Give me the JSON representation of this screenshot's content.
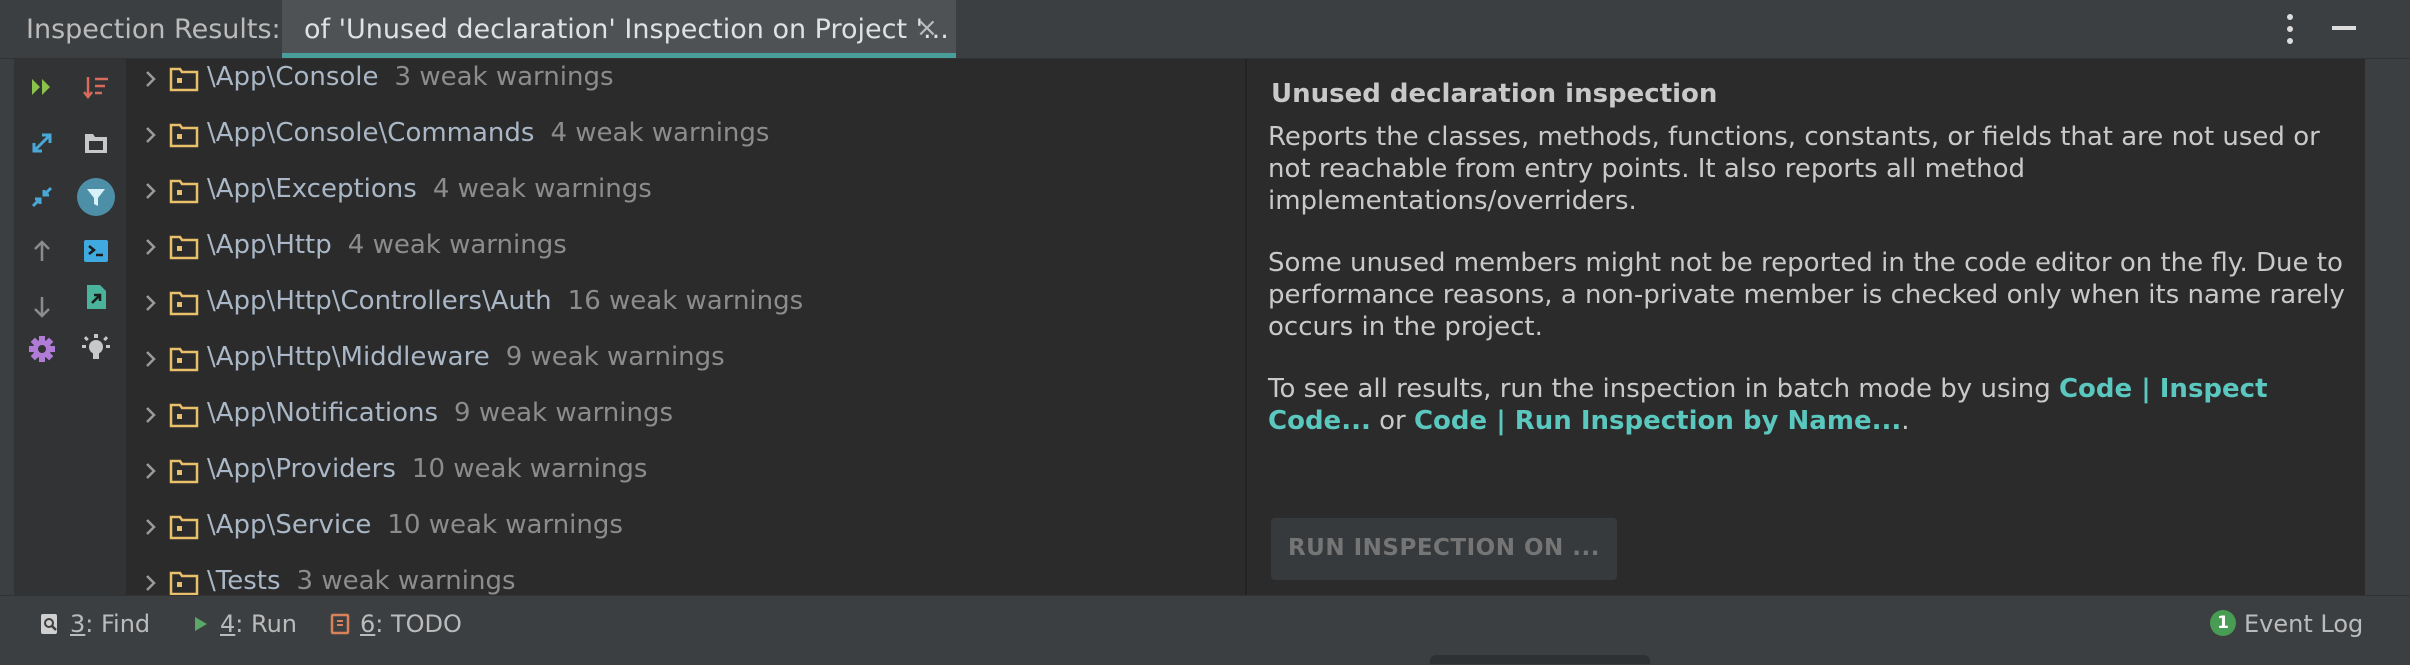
{
  "header": {
    "title": "Inspection Results:",
    "tab_label": "of 'Unused declaration' Inspection on Project '...",
    "tab_close_glyph": "×"
  },
  "toolbar": {
    "buttons": [
      {
        "name": "rerun-icon",
        "color": "#8bc34a"
      },
      {
        "name": "sort-icon",
        "color": "#d86b5b"
      },
      {
        "name": "expand-all-icon",
        "color": "#4aa8d8"
      },
      {
        "name": "group-by-directory-icon",
        "color": "#c8c8c8"
      },
      {
        "name": "collapse-all-icon",
        "color": "#4aa8d8"
      },
      {
        "name": "filter-icon",
        "color": "#4aa8d8"
      },
      {
        "name": "previous-occurrence-icon",
        "color": "#8c8c8c"
      },
      {
        "name": "autoscroll-to-source-icon",
        "color": "#3fa9e0"
      },
      {
        "name": "next-occurrence-icon",
        "color": "#8c8c8c"
      },
      {
        "name": "export-icon",
        "color": "#4ab39b"
      },
      {
        "name": "settings-icon",
        "color": "#b07cd8"
      },
      {
        "name": "quick-fix-icon",
        "color": "#c8c8c8"
      }
    ]
  },
  "tree": {
    "rows": [
      {
        "name": "\\App\\Console",
        "count": "3 weak warnings"
      },
      {
        "name": "\\App\\Console\\Commands",
        "count": "4 weak warnings"
      },
      {
        "name": "\\App\\Exceptions",
        "count": "4 weak warnings"
      },
      {
        "name": "\\App\\Http",
        "count": "4 weak warnings"
      },
      {
        "name": "\\App\\Http\\Controllers\\Auth",
        "count": "16 weak warnings"
      },
      {
        "name": "\\App\\Http\\Middleware",
        "count": "9 weak warnings"
      },
      {
        "name": "\\App\\Notifications",
        "count": "9 weak warnings"
      },
      {
        "name": "\\App\\Providers",
        "count": "10 weak warnings"
      },
      {
        "name": "\\App\\Service",
        "count": "10 weak warnings"
      },
      {
        "name": "\\Tests",
        "count": "3 weak warnings"
      }
    ]
  },
  "description": {
    "title": "Unused declaration inspection",
    "p1_line1": "Reports the classes, methods, functions, constants, or fields that are not used or",
    "p1_line2": "not reachable from entry points. It also reports all method",
    "p1_line3": "implementations/overriders.",
    "p2_line1": "Some unused members might not be reported in the code editor on the fly. Due to",
    "p2_line2": "performance reasons, a non-private member is checked only when its name rarely",
    "p2_line3": "occurs in the project.",
    "p3_prefix": "To see all results, run the inspection in batch mode by using ",
    "p3_link1_a": "Code | Inspect",
    "p3_link1_b": "Code...",
    "p3_or": " or ",
    "p3_link2": "Code | Run Inspection by Name...",
    "p3_suffix": ".",
    "run_button": "RUN INSPECTION ON ..."
  },
  "bottom_bar": {
    "find_key": "3",
    "find_label": ": Find",
    "run_key": "4",
    "run_label": ": Run",
    "todo_key": "6",
    "todo_label": ": TODO",
    "event_count": "1",
    "event_label": "Event Log"
  },
  "colors": {
    "accent": "#4a9e9a",
    "link": "#5bc8c0",
    "folder": "#e8bf6a"
  }
}
